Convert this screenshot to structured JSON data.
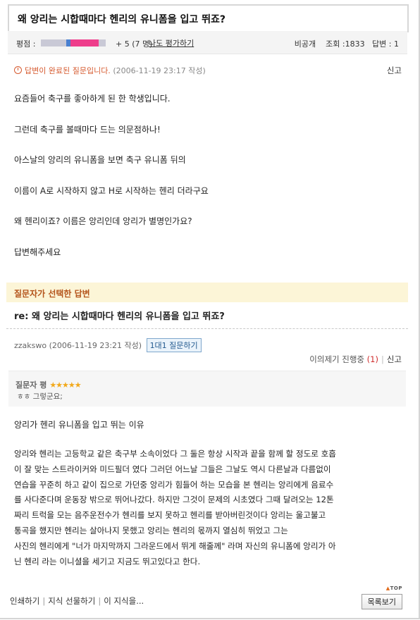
{
  "question": {
    "title": "왜 앙리는 시합때마다 헨리의 유니폼을 입고 뛰죠?",
    "rating_label": "평점 :",
    "rating_score": "+ 5 (7 명)",
    "rate_link": "나도 평가하기",
    "stats": "비공개    조회 :1833   답변 : 1",
    "status_text": "답변이 완료된 질문입니다.",
    "status_date": "(2006-11-19 23:17 작성)",
    "report": "신고",
    "body": [
      "요즘들어 축구를 좋아하게 된 한 학생입니다.",
      "그런데 축구를 볼때마다 드는 의문점하나!",
      "아스날의 앙리의 유니폼을 보면 축구 유니폼 뒤의",
      "이름이 A로 시작하지 않고 H로 시작하는 헨리 더라구요",
      "왜 헨리이죠? 이름은 앙리인데 앙리가 별명인가요?",
      "답변해주세요"
    ]
  },
  "answer": {
    "section_label": "질문자가 선택한 답변",
    "title": "re: 왜 앙리는 시합때마다 헨리의 유니폼을 입고 뛰죠?",
    "author": "zzakswo (2006-11-19 23:21 작성)",
    "one_on_one_button": "1대1 질문하기",
    "dispute_label": "이의제기 진행중",
    "dispute_count": "(1)",
    "report": "신고",
    "evaluation_label": "질문자 평",
    "stars": "★★★★★",
    "evaluation_comment": "ㅎㅎ 그렇군요;",
    "intro": "앙리가 헨리 유니폼을 입고 뛰는 이유",
    "body_lines": [
      "앙리와 헨리는 고등학교 같은 축구부 소속이었다 그 둘은 항상 시작과 끝을 함께 할 정도로 호흡",
      "이 잘 맞는 스트라이커와 미드필더 였다 그러던 어느날 그들은 그날도 역시 다른날과 다름없이",
      "연습을 꾸준히 하고 같이 집으로 가던중 앙리가 힘들어 하는 모습을 본 헨리는 앙리에게 음료수",
      "를 사다준다며 운동장 밖으로 뛰어나갔다. 하지만 그것이 문제의 시초였다 그때 달려오는 12톤",
      "짜리 트럭을 모는 음주운전수가 헨리를 보지 못하고 헨리를 받아버린것이다 앙리는 울고불고",
      "통곡을 했지만 헨리는 살아나지 못했고 앙리는 헨리의 몫까지 열심히 뛰었고 그는",
      "사진의 헨리에게 \"너가 마지막까지 그라운드에서 뛰게 해줄께\" 라며 자신의 유니폼에 앙리가 아",
      "닌 헨리 라는 이니셜을 세기고 지금도 뛰고있다고 한다."
    ]
  },
  "footer": {
    "top_label": "TOP",
    "links": [
      "인쇄하기",
      "지식 선물하기",
      "이 지식을..."
    ],
    "list_button": "목록보기"
  },
  "colors": {
    "accent_orange": "#d65a2f",
    "selected_band_bg": "#fcf5d7",
    "rating_pink": "#ee3d8b",
    "rating_blue": "#4a7fd0",
    "star_gold": "#f2a91b"
  },
  "rating_fill_fraction": 0.89
}
